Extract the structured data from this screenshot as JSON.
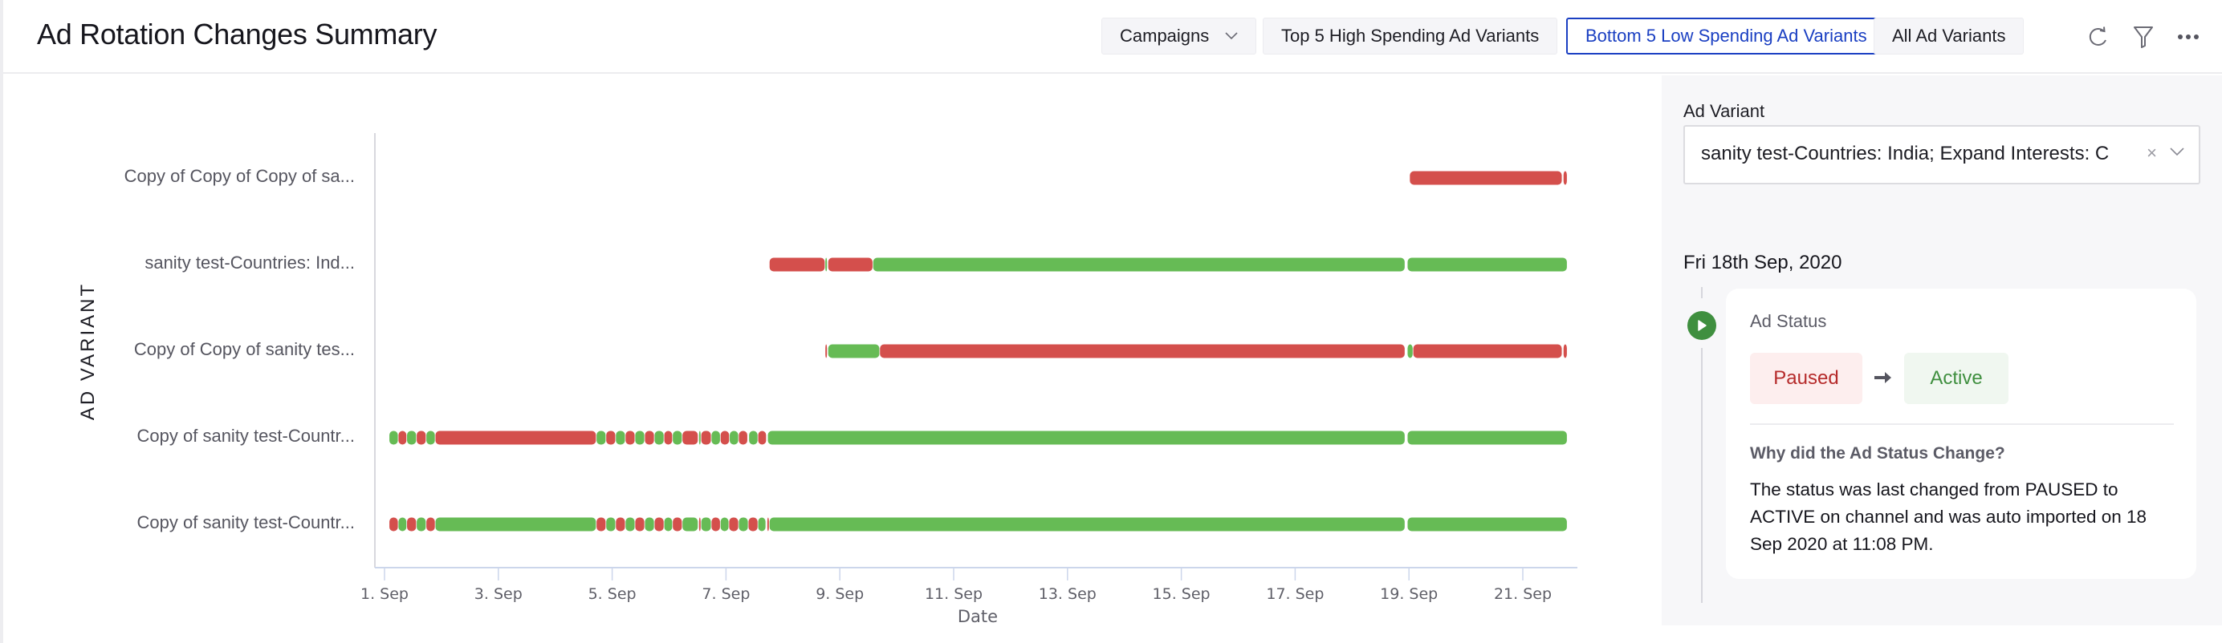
{
  "header": {
    "title": "Ad Rotation Changes Summary",
    "campaigns_dropdown": "Campaigns",
    "tabs": [
      {
        "label": "Top 5 High Spending Ad Variants",
        "active": false
      },
      {
        "label": "Bottom 5 Low Spending Ad Variants",
        "active": true
      },
      {
        "label": "All Ad Variants",
        "active": false
      }
    ],
    "icons": [
      "refresh-icon",
      "filter-icon",
      "more-icon"
    ]
  },
  "colors": {
    "active": "#66bb55",
    "paused": "#d44f4c",
    "accent": "#1a3fc2",
    "axis": "#ccd6eb"
  },
  "chart_data": {
    "type": "timeline",
    "title": "",
    "xlabel": "Date",
    "ylabel": "AD VARIANT",
    "x_range": [
      1,
      22
    ],
    "x_unit": "day of Sep 2020",
    "x_ticks": [
      "1. Sep",
      "3. Sep",
      "5. Sep",
      "7. Sep",
      "9. Sep",
      "11. Sep",
      "13. Sep",
      "15. Sep",
      "17. Sep",
      "19. Sep",
      "21. Sep"
    ],
    "x_tick_values": [
      1,
      3,
      5,
      7,
      9,
      11,
      13,
      15,
      17,
      19,
      21
    ],
    "legend": {
      "active": "Active",
      "paused": "Paused"
    },
    "categories": [
      "Copy of Copy of Copy of sa...",
      "sanity test-Countries: Ind...",
      "Copy of Copy of sanity tes...",
      "Copy of sanity test-Countr...",
      "Copy of sanity test-Countr..."
    ],
    "series": [
      {
        "name": "Copy of Copy of Copy of sa...",
        "segments": [
          {
            "status": "paused",
            "start": 19.01,
            "end": 21.69
          },
          {
            "status": "paused",
            "start": 21.71,
            "end": 21.78
          }
        ]
      },
      {
        "name": "sanity test-Countries: Ind...",
        "segments": [
          {
            "status": "paused",
            "start": 7.76,
            "end": 8.74
          },
          {
            "status": "active",
            "start": 8.74,
            "end": 8.78
          },
          {
            "status": "paused",
            "start": 8.79,
            "end": 9.58
          },
          {
            "status": "active",
            "start": 9.58,
            "end": 18.93
          },
          {
            "status": "active",
            "start": 18.97,
            "end": 21.78
          }
        ]
      },
      {
        "name": "Copy of Copy of sanity tes...",
        "segments": [
          {
            "status": "paused",
            "start": 8.74,
            "end": 8.78
          },
          {
            "status": "active",
            "start": 8.79,
            "end": 9.7
          },
          {
            "status": "paused",
            "start": 9.7,
            "end": 18.93
          },
          {
            "status": "active",
            "start": 18.97,
            "end": 19.07
          },
          {
            "status": "paused",
            "start": 19.07,
            "end": 21.69
          },
          {
            "status": "paused",
            "start": 21.71,
            "end": 21.78
          }
        ]
      },
      {
        "name": "Copy of sanity test-Countr...",
        "segments": [
          {
            "status": "active",
            "start": 1.08,
            "end": 1.24
          },
          {
            "status": "paused",
            "start": 1.24,
            "end": 1.39
          },
          {
            "status": "active",
            "start": 1.39,
            "end": 1.56
          },
          {
            "status": "paused",
            "start": 1.56,
            "end": 1.73
          },
          {
            "status": "active",
            "start": 1.73,
            "end": 1.89
          },
          {
            "status": "paused",
            "start": 1.89,
            "end": 4.72
          },
          {
            "status": "active",
            "start": 4.72,
            "end": 4.89
          },
          {
            "status": "paused",
            "start": 4.89,
            "end": 5.06
          },
          {
            "status": "active",
            "start": 5.06,
            "end": 5.23
          },
          {
            "status": "paused",
            "start": 5.23,
            "end": 5.4
          },
          {
            "status": "active",
            "start": 5.4,
            "end": 5.57
          },
          {
            "status": "paused",
            "start": 5.57,
            "end": 5.74
          },
          {
            "status": "active",
            "start": 5.74,
            "end": 5.91
          },
          {
            "status": "paused",
            "start": 5.91,
            "end": 6.06
          },
          {
            "status": "active",
            "start": 6.06,
            "end": 6.23
          },
          {
            "status": "paused",
            "start": 6.23,
            "end": 6.51
          },
          {
            "status": "active",
            "start": 6.52,
            "end": 6.55
          },
          {
            "status": "paused",
            "start": 6.56,
            "end": 6.74
          },
          {
            "status": "active",
            "start": 6.74,
            "end": 6.9
          },
          {
            "status": "paused",
            "start": 6.9,
            "end": 7.06
          },
          {
            "status": "active",
            "start": 7.06,
            "end": 7.22
          },
          {
            "status": "paused",
            "start": 7.22,
            "end": 7.38
          },
          {
            "status": "active",
            "start": 7.4,
            "end": 7.56
          },
          {
            "status": "paused",
            "start": 7.56,
            "end": 7.71
          },
          {
            "status": "active",
            "start": 7.73,
            "end": 18.93
          },
          {
            "status": "active",
            "start": 18.97,
            "end": 21.78
          }
        ]
      },
      {
        "name": "Copy of sanity test-Countr...",
        "segments": [
          {
            "status": "paused",
            "start": 1.08,
            "end": 1.24
          },
          {
            "status": "active",
            "start": 1.24,
            "end": 1.39
          },
          {
            "status": "paused",
            "start": 1.39,
            "end": 1.56
          },
          {
            "status": "active",
            "start": 1.56,
            "end": 1.73
          },
          {
            "status": "paused",
            "start": 1.73,
            "end": 1.89
          },
          {
            "status": "active",
            "start": 1.89,
            "end": 4.72
          },
          {
            "status": "paused",
            "start": 4.72,
            "end": 4.89
          },
          {
            "status": "active",
            "start": 4.89,
            "end": 5.06
          },
          {
            "status": "paused",
            "start": 5.06,
            "end": 5.23
          },
          {
            "status": "active",
            "start": 5.23,
            "end": 5.4
          },
          {
            "status": "paused",
            "start": 5.4,
            "end": 5.57
          },
          {
            "status": "active",
            "start": 5.57,
            "end": 5.74
          },
          {
            "status": "paused",
            "start": 5.74,
            "end": 5.91
          },
          {
            "status": "active",
            "start": 5.91,
            "end": 6.06
          },
          {
            "status": "paused",
            "start": 6.06,
            "end": 6.23
          },
          {
            "status": "active",
            "start": 6.23,
            "end": 6.51
          },
          {
            "status": "paused",
            "start": 6.52,
            "end": 6.55
          },
          {
            "status": "active",
            "start": 6.56,
            "end": 6.74
          },
          {
            "status": "paused",
            "start": 6.74,
            "end": 6.9
          },
          {
            "status": "active",
            "start": 6.9,
            "end": 7.05
          },
          {
            "status": "paused",
            "start": 7.05,
            "end": 7.22
          },
          {
            "status": "active",
            "start": 7.22,
            "end": 7.39
          },
          {
            "status": "paused",
            "start": 7.39,
            "end": 7.56
          },
          {
            "status": "active",
            "start": 7.56,
            "end": 7.7
          },
          {
            "status": "paused",
            "start": 7.72,
            "end": 7.75
          },
          {
            "status": "active",
            "start": 7.76,
            "end": 18.93
          },
          {
            "status": "active",
            "start": 18.97,
            "end": 21.78
          }
        ]
      }
    ]
  },
  "side_panel": {
    "ad_variant_label": "Ad Variant",
    "ad_variant_value": "sanity test-Countries: India; Expand Interests: C",
    "clear_symbol": "×",
    "date_heading": "Fri 18th Sep, 2020",
    "card": {
      "title": "Ad Status",
      "from_status": "Paused",
      "to_status": "Active",
      "why_title": "Why did the Ad Status Change?",
      "why_text": "The status was last changed from PAUSED to ACTIVE on channel and was auto imported on 18 Sep 2020 at 11:08 PM."
    }
  }
}
